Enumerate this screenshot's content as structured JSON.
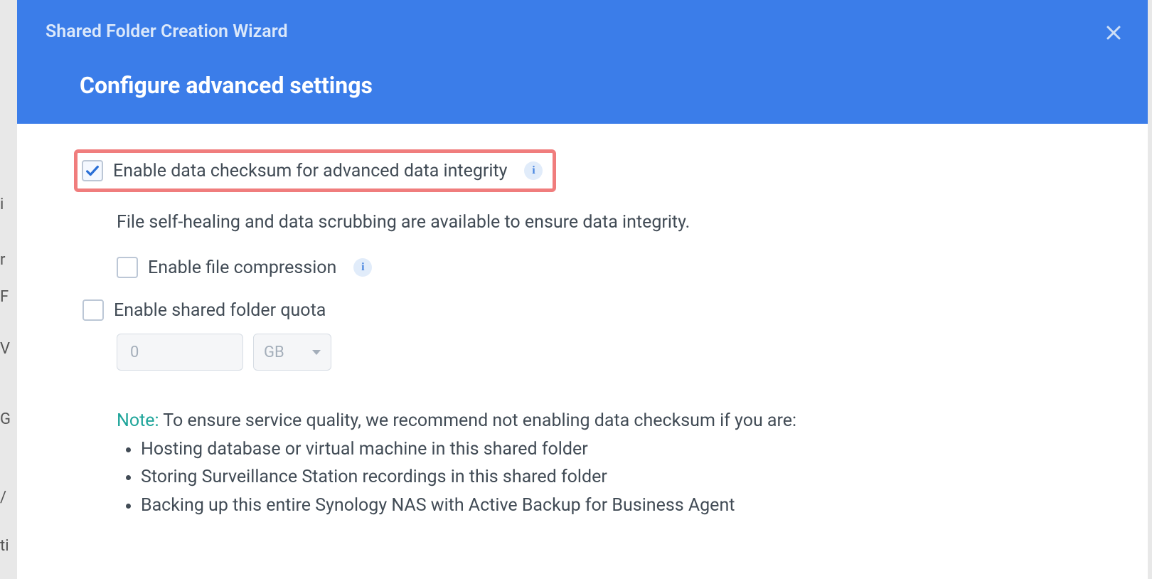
{
  "header": {
    "wizard_title": "Shared Folder Creation Wizard",
    "page_title": "Configure advanced settings"
  },
  "settings": {
    "checksum": {
      "label": "Enable data checksum for advanced data integrity",
      "checked": true,
      "description": "File self-healing and data scrubbing are available to ensure data integrity."
    },
    "compression": {
      "label": "Enable file compression",
      "checked": false
    },
    "quota": {
      "label": "Enable shared folder quota",
      "checked": false,
      "value": "0",
      "unit": "GB"
    }
  },
  "note": {
    "label": "Note:",
    "intro": " To ensure service quality, we recommend not enabling data checksum if you are:",
    "items": [
      "Hosting database or virtual machine in this shared folder",
      "Storing Surveillance Station recordings in this shared folder",
      "Backing up this entire Synology NAS with Active Backup for Business Agent"
    ]
  }
}
